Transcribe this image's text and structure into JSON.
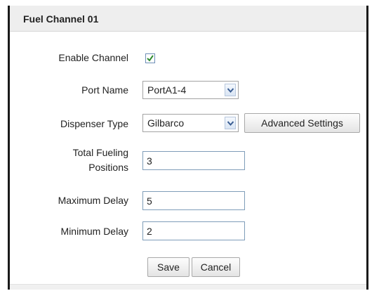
{
  "panel": {
    "title": "Fuel Channel 01"
  },
  "form": {
    "enable_channel": {
      "label": "Enable Channel",
      "checked": true
    },
    "port_name": {
      "label": "Port Name",
      "value": "PortA1-4"
    },
    "dispenser_type": {
      "label": "Dispenser Type",
      "value": "Gilbarco",
      "advanced_label": "Advanced Settings"
    },
    "total_fueling_positions": {
      "label_line1": "Total Fueling",
      "label_line2": "Positions",
      "value": "3"
    },
    "maximum_delay": {
      "label": "Maximum Delay",
      "value": "5"
    },
    "minimum_delay": {
      "label": "Minimum Delay",
      "value": "2"
    }
  },
  "actions": {
    "save_label": "Save",
    "cancel_label": "Cancel"
  },
  "icons": {
    "checkbox": "checkmark-icon",
    "dropdown": "chevron-down-icon"
  },
  "colors": {
    "checkmark": "#2e8b2e",
    "input_border": "#7f9db9",
    "header_bg": "#eeeeee"
  }
}
